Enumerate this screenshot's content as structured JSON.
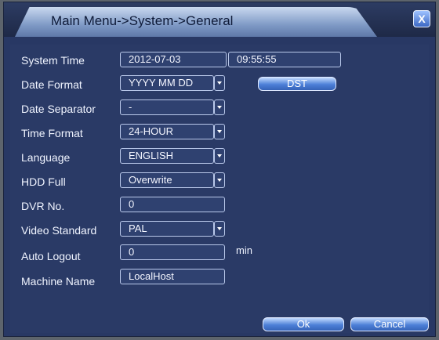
{
  "title": "Main Menu->System->General",
  "close_glyph": "X",
  "labels": {
    "system_time": "System Time",
    "date_format": "Date Format",
    "date_separator": "Date Separator",
    "time_format": "Time Format",
    "language": "Language",
    "hdd_full": "HDD Full",
    "dvr_no": "DVR No.",
    "video_standard": "Video Standard",
    "auto_logout": "Auto Logout",
    "machine_name": "Machine Name"
  },
  "values": {
    "system_date": "2012-07-03",
    "system_clock": "09:55:55",
    "date_format": "YYYY MM DD",
    "date_separator": "-",
    "time_format": "24-HOUR",
    "language": "ENGLISH",
    "hdd_full": "Overwrite",
    "dvr_no": "0",
    "video_standard": "PAL",
    "auto_logout": "0",
    "auto_logout_unit": "min",
    "machine_name": "LocalHost"
  },
  "buttons": {
    "dst": "DST",
    "ok": "Ok",
    "cancel": "Cancel"
  }
}
